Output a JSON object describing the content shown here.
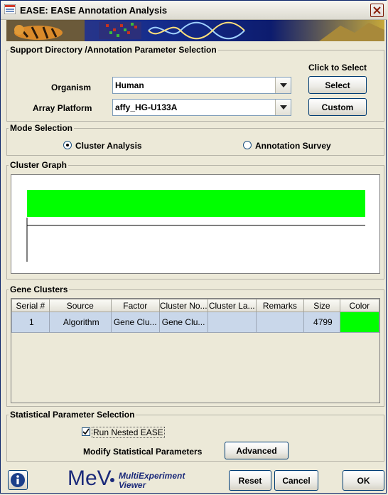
{
  "window": {
    "title": "EASE: EASE Annotation Analysis"
  },
  "support": {
    "legend": "Support Directory /Annotation Parameter Selection",
    "click_to_select": "Click to Select",
    "organism_label": "Organism",
    "organism_value": "Human",
    "select_label": "Select",
    "platform_label": "Array Platform",
    "platform_value": "affy_HG-U133A",
    "custom_label": "Custom"
  },
  "mode": {
    "legend": "Mode Selection",
    "cluster_analysis": "Cluster Analysis",
    "annotation_survey": "Annotation Survey",
    "selected": "Cluster Analysis"
  },
  "graph": {
    "legend": "Cluster Graph",
    "bar_color": "#00ff00"
  },
  "clusters": {
    "legend": "Gene Clusters",
    "columns": [
      "Serial #",
      "Source",
      "Factor",
      "Cluster No...",
      "Cluster La...",
      "Remarks",
      "Size",
      "Color"
    ],
    "rows": [
      {
        "serial": "1",
        "source": "Algorithm",
        "factor": "Gene Clu...",
        "cluster_no": "Gene Clu...",
        "cluster_label": "",
        "remarks": "",
        "size": "4799",
        "color": "#00ff00"
      }
    ]
  },
  "stats": {
    "legend": "Statistical Parameter Selection",
    "nested_label": "Run Nested EASE",
    "nested_checked": true,
    "modify_label": "Modify Statistical Parameters",
    "advanced_label": "Advanced"
  },
  "footer": {
    "logo": "MeV",
    "tagline_1": "MultiExperiment",
    "tagline_2": "Viewer",
    "reset_label": "Reset",
    "cancel_label": "Cancel",
    "ok_label": "OK"
  }
}
